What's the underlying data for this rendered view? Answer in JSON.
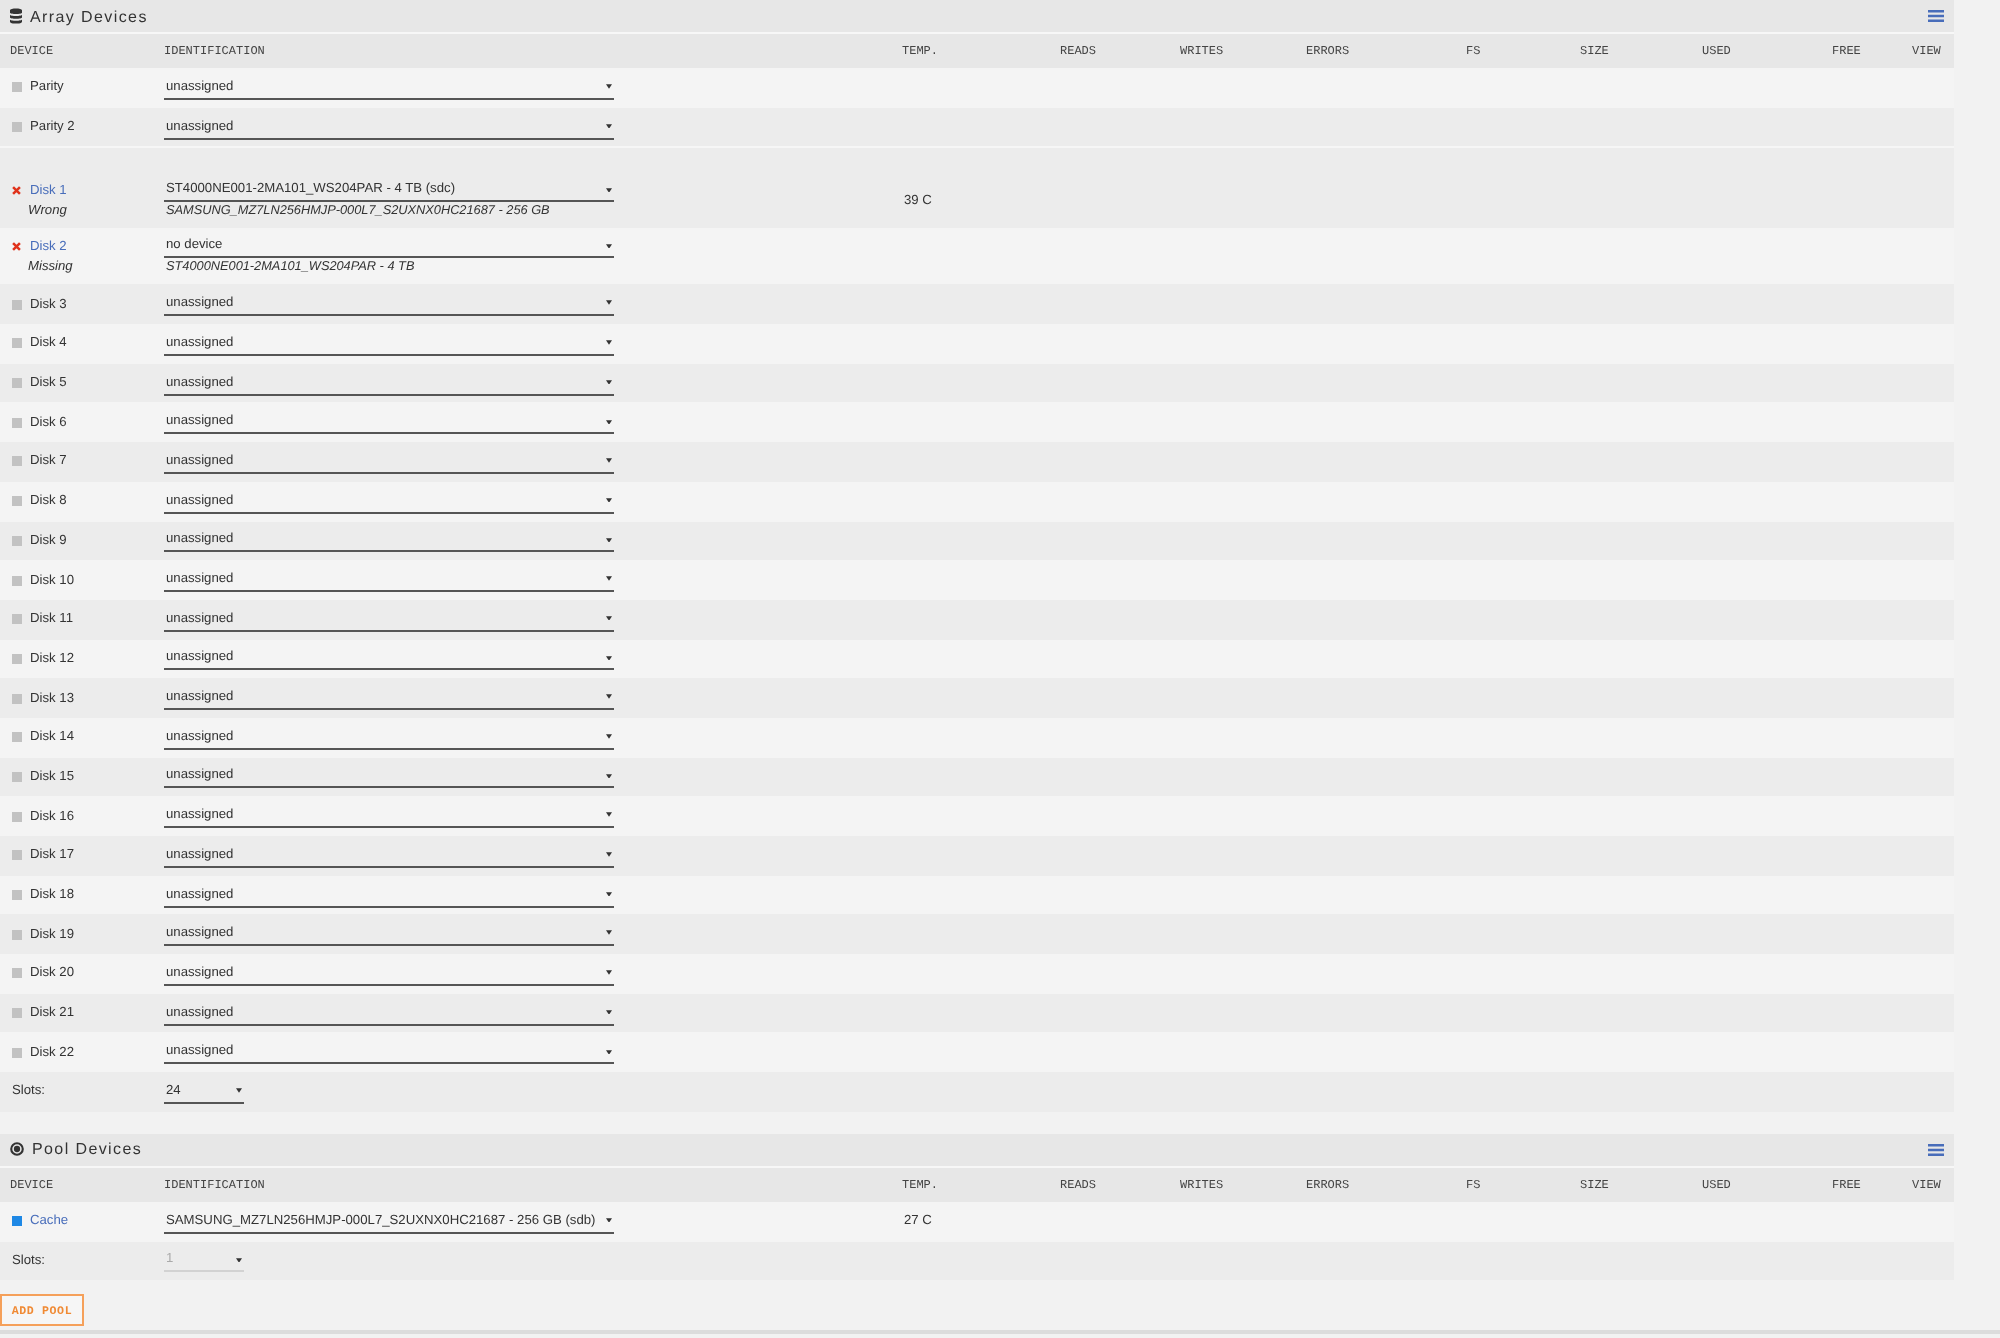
{
  "array_devices": {
    "title": "Array Devices",
    "columns": [
      "DEVICE",
      "IDENTIFICATION",
      "TEMP.",
      "READS",
      "WRITES",
      "ERRORS",
      "FS",
      "SIZE",
      "USED",
      "FREE",
      "VIEW"
    ],
    "parity": [
      {
        "device": "Parity",
        "kind": "empty",
        "identification": "unassigned"
      },
      {
        "device": "Parity 2",
        "kind": "empty",
        "identification": "unassigned"
      }
    ],
    "disks": [
      {
        "device": "Disk 1",
        "kind": "error",
        "note": "Wrong",
        "identification": "ST4000NE001-2MA101_WS204PAR - 4 TB (sdc)",
        "expected": "SAMSUNG_MZ7LN256HMJP-000L7_S2UXNX0HC21687 - 256 GB",
        "temp": "39 C"
      },
      {
        "device": "Disk 2",
        "kind": "error",
        "note": "Missing",
        "identification": "no device",
        "expected": "ST4000NE001-2MA101_WS204PAR - 4 TB"
      },
      {
        "device": "Disk 3",
        "kind": "empty",
        "identification": "unassigned"
      },
      {
        "device": "Disk 4",
        "kind": "empty",
        "identification": "unassigned"
      },
      {
        "device": "Disk 5",
        "kind": "empty",
        "identification": "unassigned"
      },
      {
        "device": "Disk 6",
        "kind": "empty",
        "identification": "unassigned"
      },
      {
        "device": "Disk 7",
        "kind": "empty",
        "identification": "unassigned"
      },
      {
        "device": "Disk 8",
        "kind": "empty",
        "identification": "unassigned"
      },
      {
        "device": "Disk 9",
        "kind": "empty",
        "identification": "unassigned"
      },
      {
        "device": "Disk 10",
        "kind": "empty",
        "identification": "unassigned"
      },
      {
        "device": "Disk 11",
        "kind": "empty",
        "identification": "unassigned"
      },
      {
        "device": "Disk 12",
        "kind": "empty",
        "identification": "unassigned"
      },
      {
        "device": "Disk 13",
        "kind": "empty",
        "identification": "unassigned"
      },
      {
        "device": "Disk 14",
        "kind": "empty",
        "identification": "unassigned"
      },
      {
        "device": "Disk 15",
        "kind": "empty",
        "identification": "unassigned"
      },
      {
        "device": "Disk 16",
        "kind": "empty",
        "identification": "unassigned"
      },
      {
        "device": "Disk 17",
        "kind": "empty",
        "identification": "unassigned"
      },
      {
        "device": "Disk 18",
        "kind": "empty",
        "identification": "unassigned"
      },
      {
        "device": "Disk 19",
        "kind": "empty",
        "identification": "unassigned"
      },
      {
        "device": "Disk 20",
        "kind": "empty",
        "identification": "unassigned"
      },
      {
        "device": "Disk 21",
        "kind": "empty",
        "identification": "unassigned"
      },
      {
        "device": "Disk 22",
        "kind": "empty",
        "identification": "unassigned"
      }
    ],
    "slots": {
      "label": "Slots:",
      "value": "24",
      "disabled": false
    }
  },
  "pool_devices": {
    "title": "Pool Devices",
    "columns": [
      "DEVICE",
      "IDENTIFICATION",
      "TEMP.",
      "READS",
      "WRITES",
      "ERRORS",
      "FS",
      "SIZE",
      "USED",
      "FREE",
      "VIEW"
    ],
    "devices": [
      {
        "device": "Cache",
        "kind": "active",
        "identification": "SAMSUNG_MZ7LN256HMJP-000L7_S2UXNX0HC21687 - 256 GB (sdb)",
        "temp": "27 C"
      }
    ],
    "slots": {
      "label": "Slots:",
      "value": "1",
      "disabled": true
    }
  },
  "add_pool_button": "ADD POOL"
}
